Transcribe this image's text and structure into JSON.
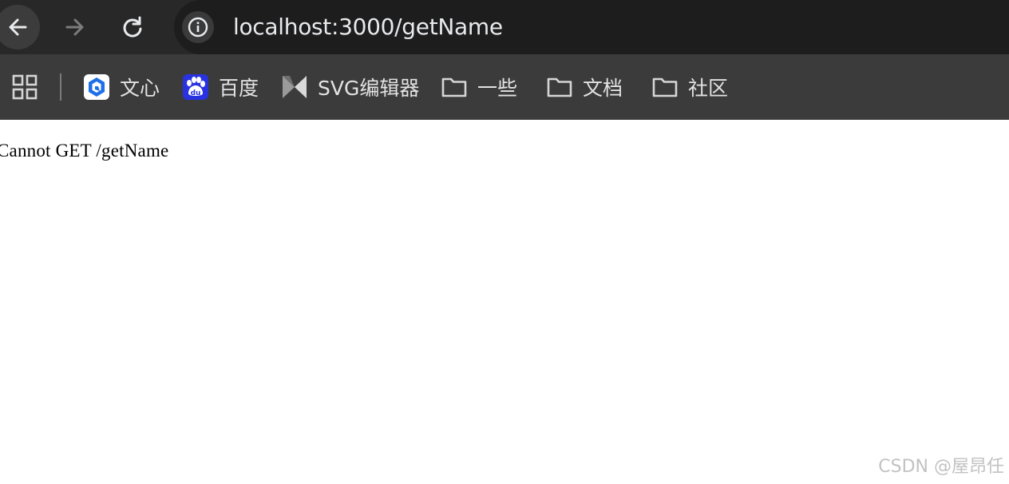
{
  "toolbar": {
    "url": "localhost:3000/getName",
    "icons": [
      "back-arrow-icon",
      "forward-arrow-icon",
      "reload-icon",
      "info-icon"
    ]
  },
  "bookmarks": {
    "apps_icon": "apps-grid-icon",
    "items": [
      {
        "label": "文心",
        "icon": "wenxin-logo-icon"
      },
      {
        "label": "百度",
        "icon": "baidu-logo-icon"
      },
      {
        "label": "SVG编辑器",
        "icon": "svg-editor-logo-icon"
      },
      {
        "label": "一些",
        "icon": "folder-icon"
      },
      {
        "label": "文档",
        "icon": "folder-icon"
      },
      {
        "label": "社区",
        "icon": "folder-icon"
      }
    ]
  },
  "page": {
    "message": "Cannot GET /getName"
  },
  "watermark": "CSDN @屋昂任",
  "colors": {
    "toolbar_bg": "#282828",
    "omnibox_bg": "#1d1d1d",
    "bookmarks_bg": "#3b3b3b",
    "page_bg": "#ffffff"
  }
}
